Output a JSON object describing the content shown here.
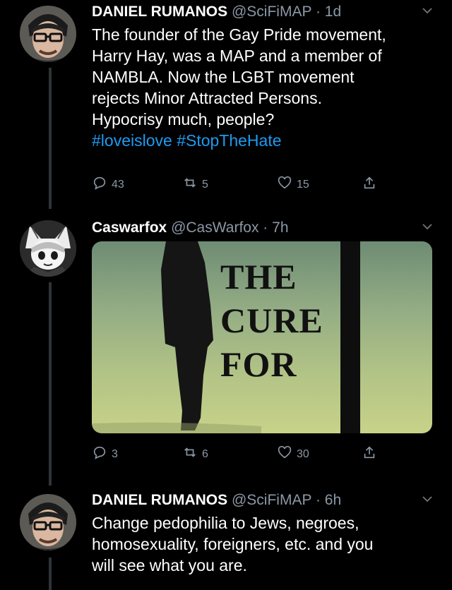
{
  "tweets": [
    {
      "name": "DANIEL RUMANOS",
      "handle": "@SciFiMAP",
      "dot": "·",
      "time": "1d",
      "text_lines": [
        "The founder of the Gay Pride movement,",
        "Harry Hay, was a MAP and a member of",
        "NAMBLA. Now the LGBT movement",
        "rejects Minor Attracted Persons.",
        "Hypocrisy much, people?"
      ],
      "hashtags": [
        "#loveislove",
        "#StopTheHate"
      ],
      "replies": "43",
      "retweets": "5",
      "likes": "15"
    },
    {
      "name": "Caswarfox",
      "handle": "@CasWarfox",
      "dot": "·",
      "time": "7h",
      "media_text": [
        "THE",
        "CURE",
        "FOR"
      ],
      "replies": "3",
      "retweets": "6",
      "likes": "30"
    },
    {
      "name": "DANIEL RUMANOS",
      "handle": "@SciFiMAP",
      "dot": "·",
      "time": "6h",
      "text_lines": [
        "Change pedophilia to Jews, negroes,",
        "homosexuality, foreigners, etc. and you",
        "will see what you are."
      ]
    }
  ],
  "colors": {
    "background": "#000000",
    "link": "#1d9bf0",
    "muted": "#8b98a5"
  },
  "icons": [
    "reply-icon",
    "retweet-icon",
    "like-icon",
    "share-icon",
    "chevron-down-icon"
  ]
}
